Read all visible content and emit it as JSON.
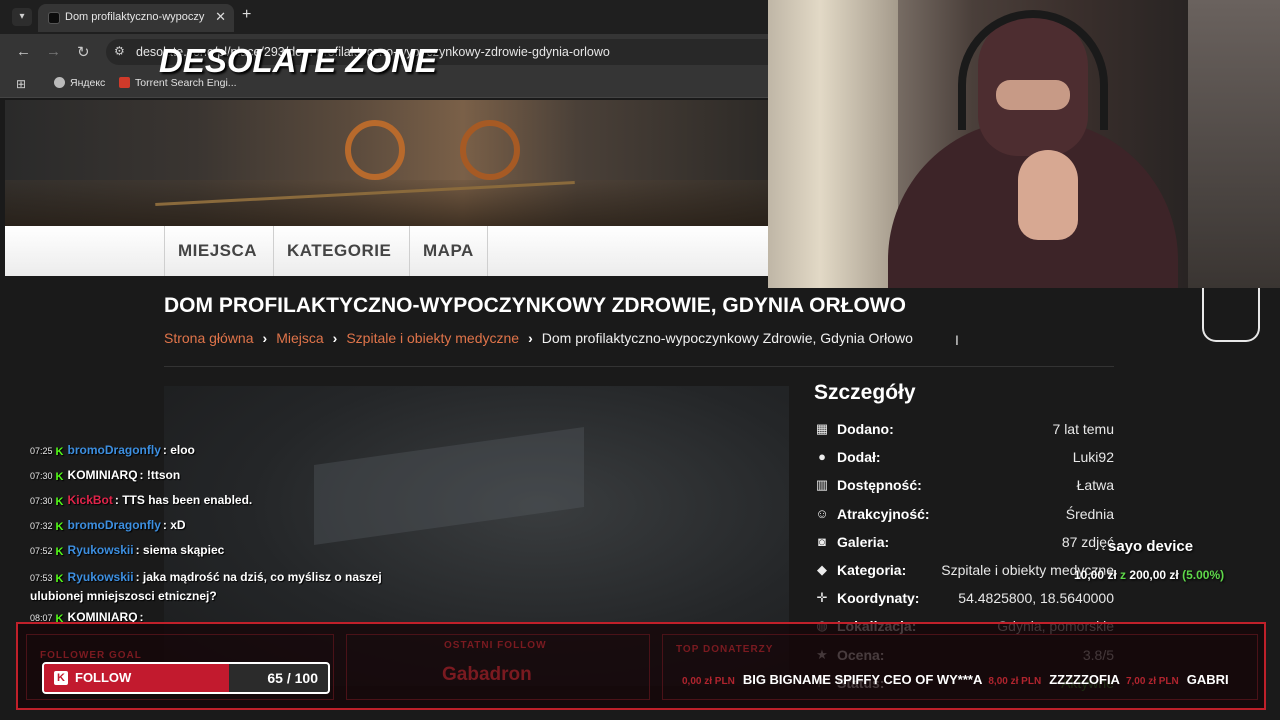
{
  "browser": {
    "tab_title": "Dom profilaktyczno-wypoczynk",
    "url": "desolate.zone/pl/place/293/dom-profilaktyczno-wypoczynkowy-zdrowie-gdynia-orlowo",
    "bookmarks": [
      "Яндекс",
      "Torrent Search Engi..."
    ]
  },
  "site": {
    "logo": "DESOLATE ZONE",
    "nav": [
      "MIEJSCA",
      "KATEGORIE",
      "MAPA"
    ],
    "page_title": "DOM PROFILAKTYCZNO-WYPOCZYNKOWY ZDROWIE, GDYNIA ORŁOWO",
    "breadcrumbs": [
      "Strona główna",
      "Miejsca",
      "Szpitale i obiekty medyczne"
    ],
    "breadcrumb_current": "Dom profilaktyczno-wypoczynkowy Zdrowie, Gdynia Orłowo"
  },
  "details": {
    "title": "Szczegóły",
    "rows": [
      {
        "icon": "calendar-icon",
        "label": "Dodano:",
        "value": "7 lat temu"
      },
      {
        "icon": "user-icon",
        "label": "Dodał:",
        "value": "Luki92"
      },
      {
        "icon": "bar-chart-icon",
        "label": "Dostępność:",
        "value": "Łatwa"
      },
      {
        "icon": "smile-icon",
        "label": "Atrakcyjność:",
        "value": "Średnia"
      },
      {
        "icon": "camera-icon",
        "label": "Galeria:",
        "value": "87 zdjęć"
      },
      {
        "icon": "tag-icon",
        "label": "Kategoria:",
        "value": "Szpitale i obiekty medyczne"
      },
      {
        "icon": "crosshair-icon",
        "label": "Koordynaty:",
        "value": "54.4825800, 18.5640000"
      },
      {
        "icon": "globe-icon",
        "label": "Lokalizacja:",
        "value": "Gdynia, pomorskie"
      },
      {
        "icon": "star-icon",
        "label": "Ocena:",
        "value": "3.8/5"
      },
      {
        "icon": "flag-icon",
        "label": "Status:",
        "value": "Aktywne"
      }
    ]
  },
  "chat": [
    {
      "time": "07:25",
      "user": "bromoDragonfly",
      "user_color": "#3d8fe0",
      "text": "eloo"
    },
    {
      "time": "07:30",
      "user": "KOMINIARQ",
      "user_color": "#ffffff",
      "text": "!ttson"
    },
    {
      "time": "07:30",
      "user": "KickBot",
      "user_color": "#e0244a",
      "text": "TTS has been enabled."
    },
    {
      "time": "07:32",
      "user": "bromoDragonfly",
      "user_color": "#3d8fe0",
      "text": "xD"
    },
    {
      "time": "07:52",
      "user": "Ryukowskii",
      "user_color": "#3d8fe0",
      "text": "siema skąpiec"
    },
    {
      "time": "07:53",
      "user": "Ryukowskii",
      "user_color": "#3d8fe0",
      "text": "jaka mądrość na dziś, co myślisz o naszej ulubionej mniejszosci etnicznej?"
    },
    {
      "time": "08:07",
      "user": "KOMINIARQ",
      "user_color": "#ffffff",
      "text": ""
    }
  ],
  "stream": {
    "follower_goal_label": "FOLLOWER GOAL",
    "follow_label": "FOLLOW",
    "follow_count": "65 / 100",
    "follow_progress": 0.65,
    "last_follow_label": "OSTATNI FOLLOW",
    "last_follow_name": "Gabadron",
    "top_donators_label": "TOP DONATERZY",
    "ticker": [
      {
        "amount": "0,00 zł PLN",
        "name": "BIG BIGNAME SPIFFY CEO OF WY***A"
      },
      {
        "amount": "8,00 zł PLN",
        "name": "ZZZZZOFIA"
      },
      {
        "amount": "7,00 zł PLN",
        "name": "GABRI"
      }
    ],
    "donation_title": "sayo device",
    "donation_current": "10,00 zł",
    "donation_sep": "z",
    "donation_goal": "200,00 zł",
    "donation_pct": "(5.00%)"
  },
  "colors": {
    "accent_link": "#e0744a",
    "stream_red": "#c0202a",
    "kick_green": "#53fc18"
  }
}
